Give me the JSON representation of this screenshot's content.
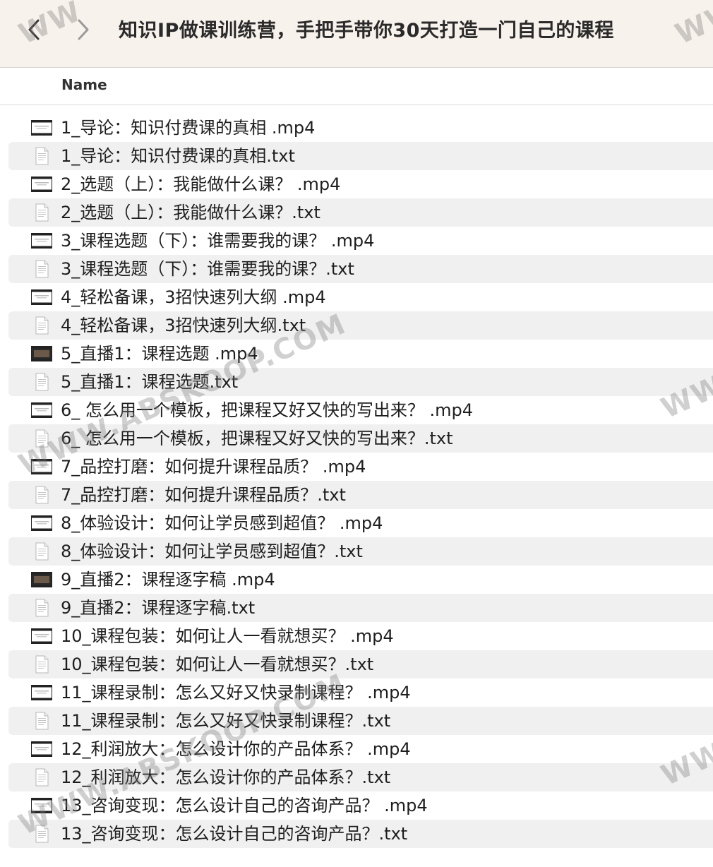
{
  "toolbar": {
    "back_icon": "chevron-left-icon",
    "forward_icon": "chevron-right-icon",
    "title": "知识IP做课训练营，手把手带你30天打造一门自己的课程",
    "background": "#f8f2ec"
  },
  "header": {
    "name_column": "Name"
  },
  "files": [
    {
      "name": "1_导论：知识付费课的真相  .mp4",
      "type": "video",
      "thumb": "light"
    },
    {
      "name": "1_导论：知识付费课的真相.txt",
      "type": "text"
    },
    {
      "name": "2_选题（上）：我能做什么课？  .mp4",
      "type": "video",
      "thumb": "light"
    },
    {
      "name": "2_选题（上）：我能做什么课？.txt",
      "type": "text"
    },
    {
      "name": "3_课程选题（下）：谁需要我的课？  .mp4",
      "type": "video",
      "thumb": "light"
    },
    {
      "name": "3_课程选题（下）：谁需要我的课？.txt",
      "type": "text"
    },
    {
      "name": "4_轻松备课，3招快速列大纲 .mp4",
      "type": "video",
      "thumb": "light"
    },
    {
      "name": "4_轻松备课，3招快速列大纲.txt",
      "type": "text"
    },
    {
      "name": "5_直播1：课程选题 .mp4",
      "type": "video",
      "thumb": "dark"
    },
    {
      "name": "5_直播1：课程选题.txt",
      "type": "text"
    },
    {
      "name": "6_ 怎么用一个模板，把课程又好又快的写出来？ .mp4",
      "type": "video",
      "thumb": "light"
    },
    {
      "name": "6_ 怎么用一个模板，把课程又好又快的写出来？.txt",
      "type": "text"
    },
    {
      "name": "7_品控打磨：如何提升课程品质？ .mp4",
      "type": "video",
      "thumb": "light"
    },
    {
      "name": "7_品控打磨：如何提升课程品质？.txt",
      "type": "text"
    },
    {
      "name": "8_体验设计：如何让学员感到超值？ .mp4",
      "type": "video",
      "thumb": "light"
    },
    {
      "name": "8_体验设计：如何让学员感到超值？.txt",
      "type": "text"
    },
    {
      "name": "9_直播2：课程逐字稿 .mp4",
      "type": "video",
      "thumb": "dark"
    },
    {
      "name": "9_直播2：课程逐字稿.txt",
      "type": "text"
    },
    {
      "name": "10_课程包装：如何让人一看就想买？ .mp4",
      "type": "video",
      "thumb": "light"
    },
    {
      "name": "10_课程包装：如何让人一看就想买？.txt",
      "type": "text"
    },
    {
      "name": "11_课程录制：怎么又好又快录制课程？ .mp4",
      "type": "video",
      "thumb": "light"
    },
    {
      "name": "11_课程录制：怎么又好又快录制课程？.txt",
      "type": "text"
    },
    {
      "name": "12_利润放大：怎么设计你的产品体系？ .mp4",
      "type": "video",
      "thumb": "light"
    },
    {
      "name": "12_利润放大：怎么设计你的产品体系？.txt",
      "type": "text"
    },
    {
      "name": "13_咨询变现：怎么设计自己的咨询产品？ .mp4",
      "type": "video",
      "thumb": "light"
    },
    {
      "name": "13_咨询变现：怎么设计自己的咨询产品？.txt",
      "type": "text"
    }
  ],
  "watermark": {
    "text": "WWW.ABSKOOP.COM",
    "partial_text": "WW"
  }
}
